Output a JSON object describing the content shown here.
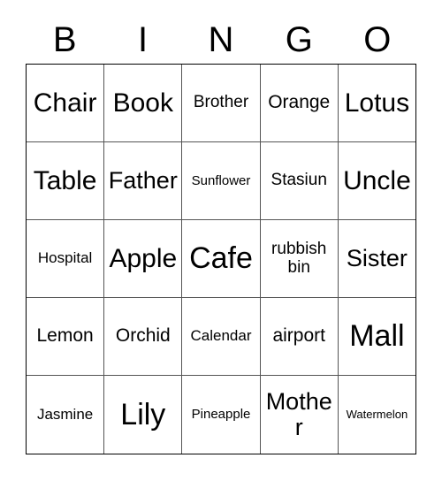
{
  "card": {
    "title": "BINGO",
    "header_letters": [
      "B",
      "I",
      "N",
      "G",
      "O"
    ],
    "grid_size": "5x5",
    "text_color": "#000000",
    "background_color": "#ffffff",
    "border_color": "#000000",
    "gridline_color": "#555555",
    "rows": [
      [
        {
          "label": "Chair",
          "size": "xxl"
        },
        {
          "label": "Book",
          "size": "xxl"
        },
        {
          "label": "Brother",
          "size": "m"
        },
        {
          "label": "Orange",
          "size": "ml"
        },
        {
          "label": "Lotus",
          "size": "xxl"
        }
      ],
      [
        {
          "label": "Table",
          "size": "xxl"
        },
        {
          "label": "Father",
          "size": "xl"
        },
        {
          "label": "Sunflower",
          "size": "s"
        },
        {
          "label": "Stasiun",
          "size": "m"
        },
        {
          "label": "Uncle",
          "size": "xxl"
        }
      ],
      [
        {
          "label": "Hospital",
          "size": "sm"
        },
        {
          "label": "Apple",
          "size": "xxl"
        },
        {
          "label": "Cafe",
          "size": "huge"
        },
        {
          "label": "rubbish bin",
          "size": "m"
        },
        {
          "label": "Sister",
          "size": "xl"
        }
      ],
      [
        {
          "label": "Lemon",
          "size": "ml"
        },
        {
          "label": "Orchid",
          "size": "ml"
        },
        {
          "label": "Calendar",
          "size": "sm"
        },
        {
          "label": "airport",
          "size": "ml"
        },
        {
          "label": "Mall",
          "size": "huge"
        }
      ],
      [
        {
          "label": "Jasmine",
          "size": "sm"
        },
        {
          "label": "Lily",
          "size": "huge"
        },
        {
          "label": "Pineapple",
          "size": "s"
        },
        {
          "label": "Mother",
          "size": "xl"
        },
        {
          "label": "Watermelon",
          "size": "xs"
        }
      ]
    ]
  }
}
